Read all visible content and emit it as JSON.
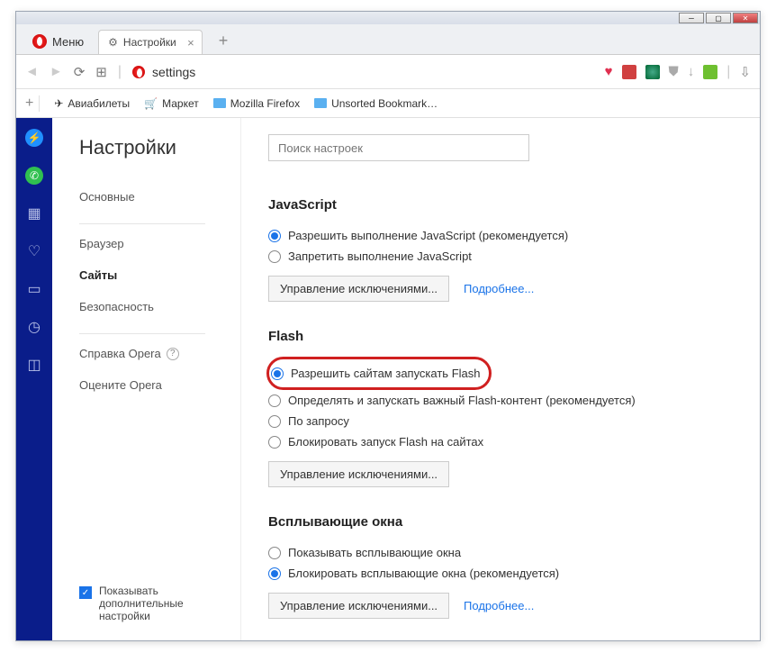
{
  "window": {
    "menu_label": "Меню"
  },
  "tab": {
    "title": "Настройки",
    "gear_icon": "⚙"
  },
  "address": {
    "url": "settings"
  },
  "bookmarks": {
    "items": [
      {
        "label": "Авиабилеты",
        "icon": "plane"
      },
      {
        "label": "Маркет",
        "icon": "cart"
      },
      {
        "label": "Mozilla Firefox",
        "icon": "folder"
      },
      {
        "label": "Unsorted Bookmark…",
        "icon": "folder"
      }
    ]
  },
  "settings": {
    "title": "Настройки",
    "search_placeholder": "Поиск настроек",
    "nav": {
      "basic": "Основные",
      "browser": "Браузер",
      "sites": "Сайты",
      "security": "Безопасность",
      "help": "Справка Opera",
      "rate": "Оцените Opera"
    },
    "show_advanced": "Показывать дополнительные настройки"
  },
  "sections": {
    "javascript": {
      "title": "JavaScript",
      "allow": "Разрешить выполнение JavaScript (рекомендуется)",
      "deny": "Запретить выполнение JavaScript",
      "manage": "Управление исключениями...",
      "more": "Подробнее..."
    },
    "flash": {
      "title": "Flash",
      "allow": "Разрешить сайтам запускать Flash",
      "detect": "Определять и запускать важный Flash-контент (рекомендуется)",
      "ondemand": "По запросу",
      "block": "Блокировать запуск Flash на сайтах",
      "manage": "Управление исключениями..."
    },
    "popups": {
      "title": "Всплывающие окна",
      "show": "Показывать всплывающие окна",
      "block": "Блокировать всплывающие окна (рекомендуется)",
      "manage": "Управление исключениями...",
      "more": "Подробнее..."
    }
  }
}
